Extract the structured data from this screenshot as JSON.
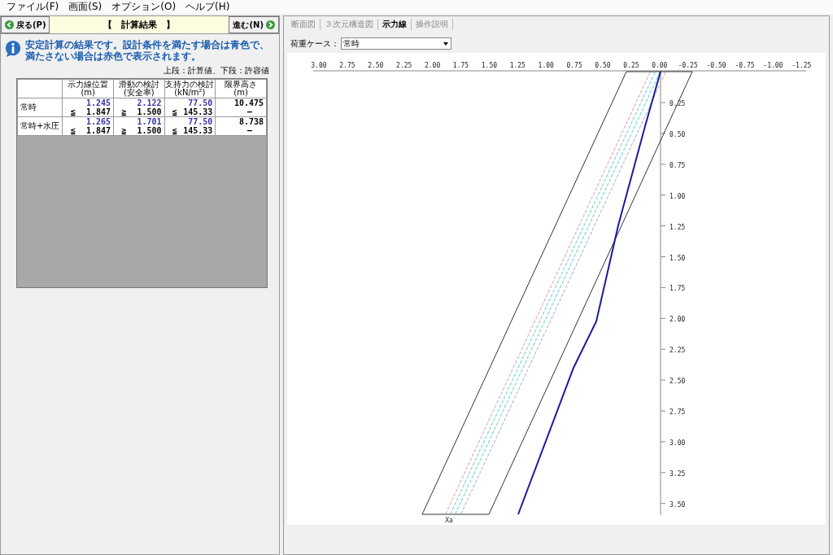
{
  "menu": [
    "ファイル(F)",
    "画面(S)",
    "オプション(O)",
    "ヘルプ(H)"
  ],
  "nav": {
    "back": "戻る(P)",
    "title": "【　計算結果　】",
    "forward": "進む(N)"
  },
  "info": "安定計算の結果です。設計条件を満たす場合は青色で、満たさない場合は赤色で表示されます。",
  "legend": "上段：計算値、下段：許容値",
  "table": {
    "columns": [
      "示力線位置\n(m)",
      "滑動の検討\n(安全率)",
      "支持力の検討\n(kN/m²)",
      "限界高さ\n(m)"
    ],
    "rows": [
      {
        "label": "常時",
        "calc": [
          {
            "text": "1.245",
            "color": "#3333aa"
          },
          {
            "text": "2.122",
            "color": "#3333aa"
          },
          {
            "text": "77.50",
            "color": "#3333aa"
          },
          {
            "text": "10.475",
            "color": "#000000"
          }
        ],
        "allow": [
          {
            "sign": "≦",
            "text": "1.847"
          },
          {
            "sign": "≧",
            "text": "1.500"
          },
          {
            "sign": "≦",
            "text": "145.33"
          },
          {
            "text": "—"
          }
        ]
      },
      {
        "label": "常時+水圧",
        "calc": [
          {
            "text": "1.265",
            "color": "#3333aa"
          },
          {
            "text": "1.701",
            "color": "#3333aa"
          },
          {
            "text": "77.50",
            "color": "#3333aa"
          },
          {
            "text": "8.738",
            "color": "#000000"
          }
        ],
        "allow": [
          {
            "sign": "≦",
            "text": "1.847"
          },
          {
            "sign": "≧",
            "text": "1.500"
          },
          {
            "sign": "≦",
            "text": "145.33"
          },
          {
            "text": "—"
          }
        ]
      }
    ]
  },
  "tabs": [
    {
      "label": "断面図",
      "selected": false
    },
    {
      "label": "３次元構造図",
      "selected": false
    },
    {
      "label": "示力線",
      "selected": true
    },
    {
      "label": "操作説明",
      "selected": false
    }
  ],
  "load_case": {
    "label": "荷重ケース：",
    "value": "常時"
  },
  "diagram": {
    "x_ticks": [
      "3.00",
      "2.75",
      "2.50",
      "2.25",
      "2.00",
      "1.75",
      "1.50",
      "1.25",
      "1.00",
      "0.75",
      "0.50",
      "0.25",
      "0.00",
      "-0.25",
      "-0.50",
      "-0.75",
      "-1.00",
      "-1.25"
    ],
    "y_ticks": [
      "0.25",
      "0.50",
      "0.75",
      "1.00",
      "1.25",
      "1.50",
      "1.75",
      "2.00",
      "2.25",
      "2.50",
      "2.75",
      "3.00",
      "3.25",
      "3.50"
    ],
    "base_label": "Xa"
  }
}
